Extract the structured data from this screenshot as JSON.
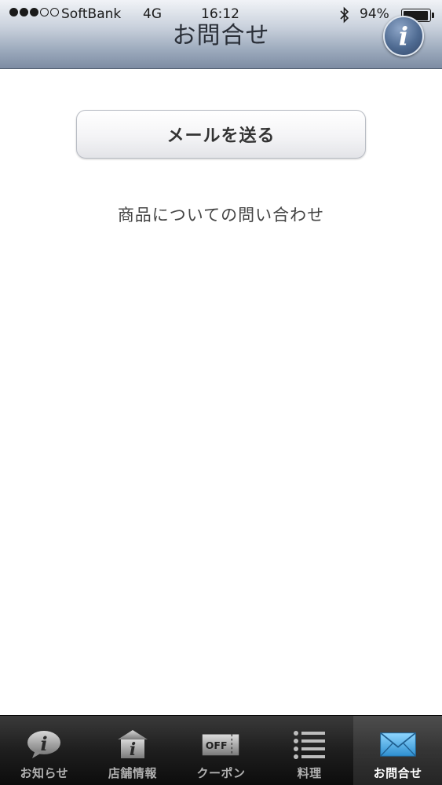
{
  "status_bar": {
    "carrier": "SoftBank",
    "network": "4G",
    "time": "16:12",
    "battery_percent": "94%",
    "battery_level": 0.94,
    "signal_strength": 3,
    "signal_max": 5
  },
  "header": {
    "title": "お問合せ",
    "info_icon": "info-icon"
  },
  "main": {
    "send_mail_label": "メールを送る",
    "description": "商品についての問い合わせ"
  },
  "tab_bar": {
    "tabs": [
      {
        "label": "お知らせ",
        "icon": "info-bubble-icon",
        "active": false
      },
      {
        "label": "店舗情報",
        "icon": "store-icon",
        "active": false
      },
      {
        "label": "クーポン",
        "icon": "coupon-icon",
        "active": false
      },
      {
        "label": "料理",
        "icon": "list-icon",
        "active": false
      },
      {
        "label": "お問合せ",
        "icon": "mail-icon",
        "active": true
      }
    ],
    "coupon_icon_text": "OFF"
  },
  "colors": {
    "accent_mail": "#4fb3e8",
    "tab_bar_bg": "#1e1e1e",
    "header_bottom": "#7d8ca3"
  }
}
